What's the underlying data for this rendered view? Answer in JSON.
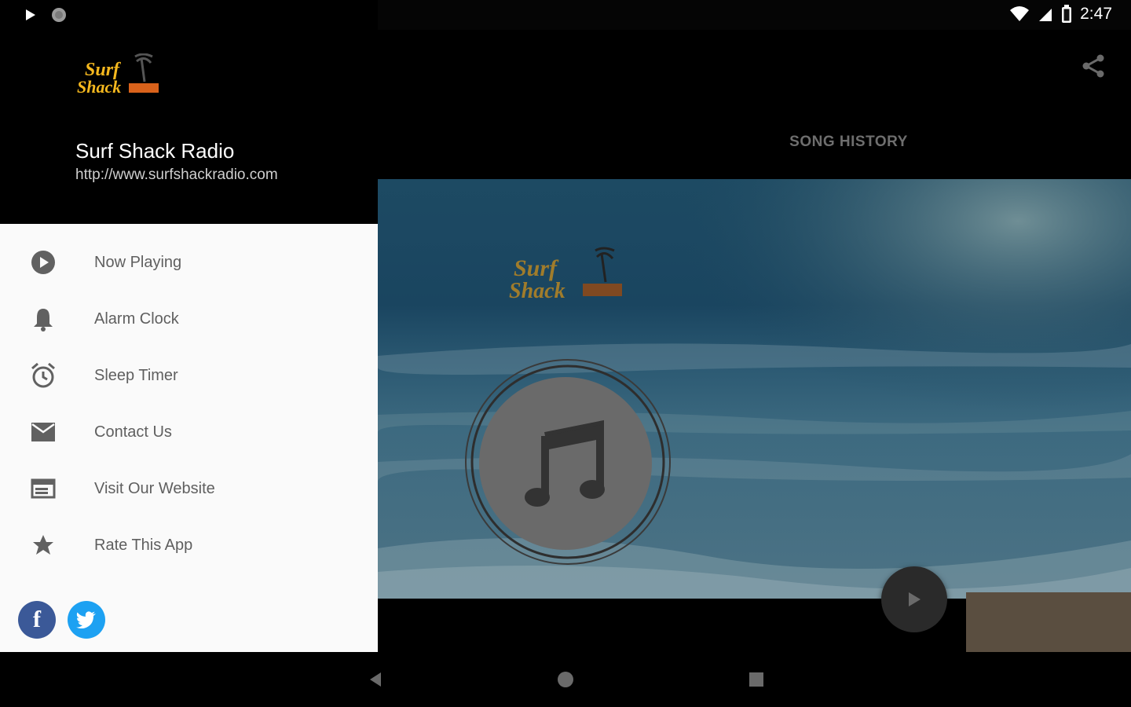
{
  "status_bar": {
    "time": "2:47",
    "icons": [
      "play-icon",
      "record-icon",
      "wifi-icon",
      "signal-icon",
      "battery-icon"
    ]
  },
  "drawer": {
    "station_name": "Surf Shack Radio",
    "station_url": "http://www.surfshackradio.com",
    "menu": [
      {
        "label": "Now Playing",
        "icon": "play-circle-icon"
      },
      {
        "label": "Alarm Clock",
        "icon": "bell-icon"
      },
      {
        "label": "Sleep Timer",
        "icon": "alarm-clock-icon"
      },
      {
        "label": "Contact Us",
        "icon": "mail-icon"
      },
      {
        "label": "Visit Our Website",
        "icon": "web-icon"
      },
      {
        "label": "Rate This App",
        "icon": "star-icon"
      }
    ],
    "social": [
      {
        "name": "facebook",
        "glyph": "f",
        "color": "#3b5998"
      },
      {
        "name": "twitter",
        "color": "#1da1f2"
      }
    ]
  },
  "main": {
    "song_history_label": "SONG HISTORY",
    "share_icon": "share-icon",
    "play_icon": "play-icon",
    "music_icon": "music-note-icon"
  },
  "colors": {
    "drawer_bg": "#fafafa",
    "menu_text": "#5f5f5f",
    "logo_orange": "#f5a623"
  }
}
